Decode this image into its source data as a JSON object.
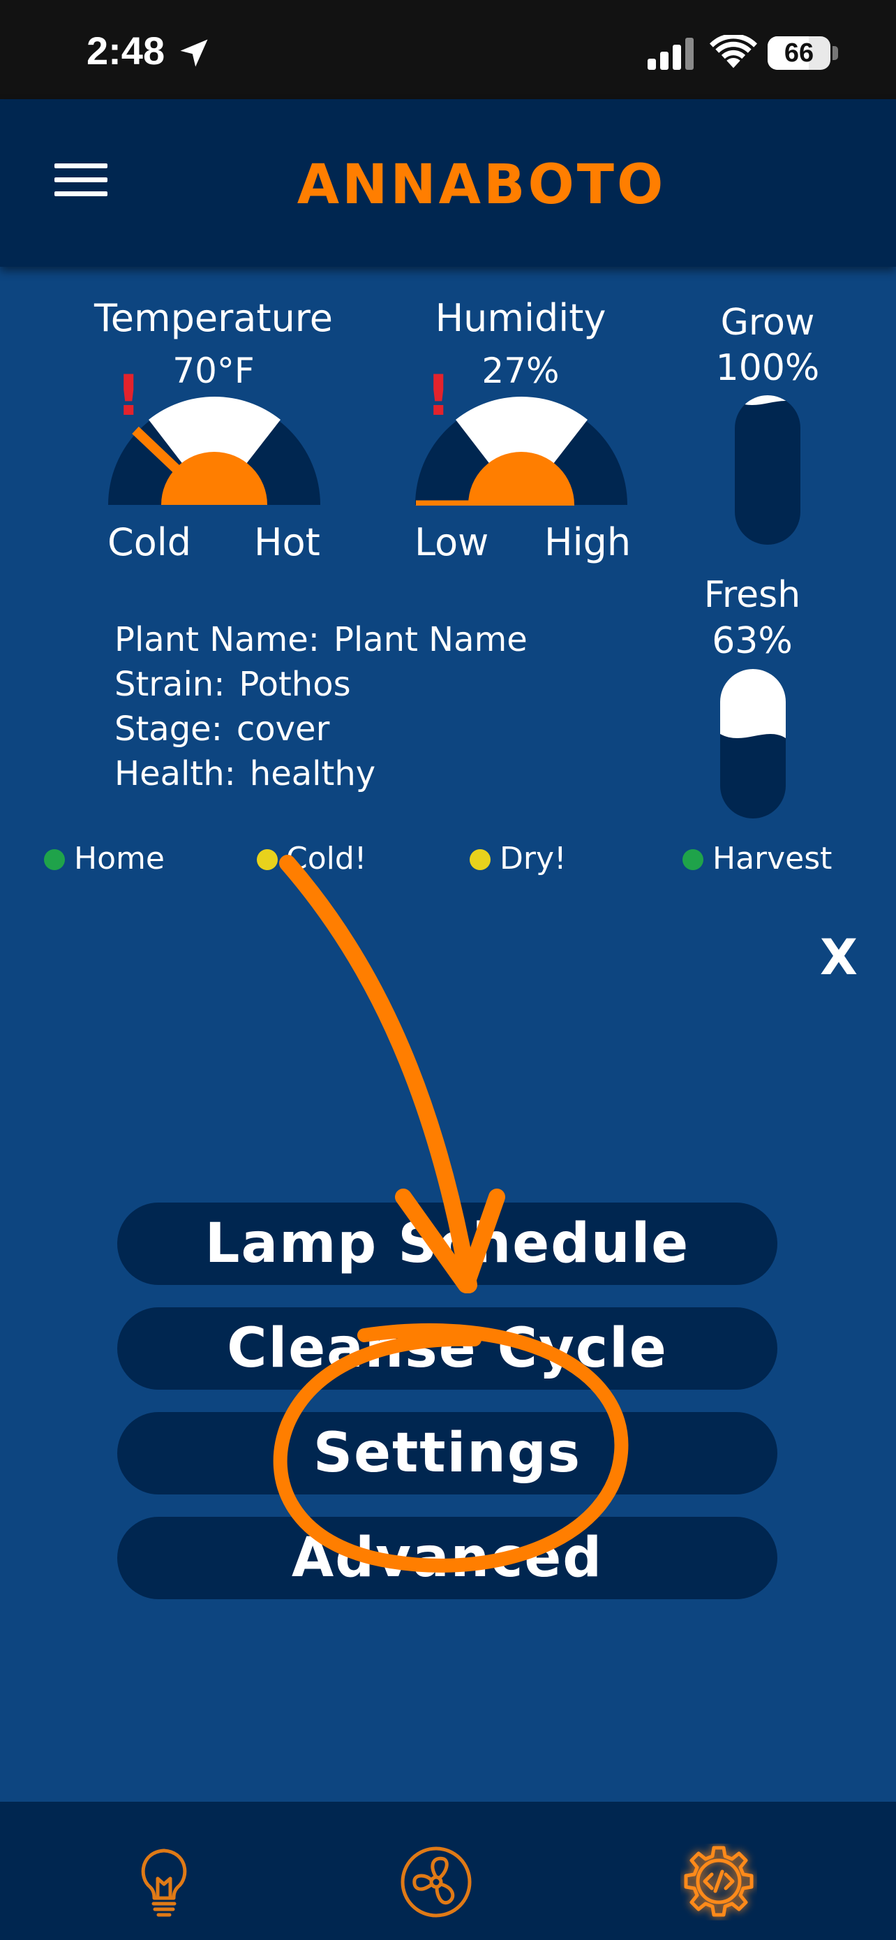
{
  "status_bar": {
    "time": "2:48",
    "battery": "66",
    "battery_level": 0.66,
    "icons": [
      "location-arrow-icon",
      "cellular-signal-icon",
      "wifi-icon",
      "battery-icon"
    ]
  },
  "header": {
    "title": "ANNABOTO",
    "menu_icon": "hamburger-menu-icon"
  },
  "gauges": {
    "temperature": {
      "title": "Temperature",
      "value": "70°F",
      "low_label": "Cold",
      "high_label": "Hot",
      "warning": "!"
    },
    "humidity": {
      "title": "Humidity",
      "value": "27%",
      "low_label": "Low",
      "high_label": "High",
      "warning": "!"
    }
  },
  "levels": {
    "grow": {
      "label": "Grow",
      "value": "100%",
      "level": 1.0
    },
    "fresh": {
      "label": "Fresh",
      "value": "63%",
      "level": 0.63
    }
  },
  "plant_info": [
    {
      "key": "Plant Name:",
      "value": "Plant Name"
    },
    {
      "key": "Strain:",
      "value": "Pothos"
    },
    {
      "key": "Stage:",
      "value": "cover"
    },
    {
      "key": "Health:",
      "value": "healthy"
    }
  ],
  "indicators": [
    {
      "label": "Home",
      "color": "#1fa34a"
    },
    {
      "label": "Cold!",
      "color": "#e8d21c"
    },
    {
      "label": "Dry!",
      "color": "#e8d21c"
    },
    {
      "label": "Harvest",
      "color": "#1fa34a"
    }
  ],
  "close_label": "X",
  "menu": {
    "items": [
      "Lamp Schedule",
      "Cleanse Cycle",
      "Settings",
      "Advanced"
    ]
  },
  "bottom_nav": {
    "icons": [
      "light-bulb-icon",
      "fan-icon",
      "code-settings-icon"
    ],
    "active": "code-settings-icon"
  },
  "colors": {
    "background": "#0d4580",
    "panel": "#002650",
    "accent": "#ff7e00",
    "warning": "#e3232c"
  }
}
